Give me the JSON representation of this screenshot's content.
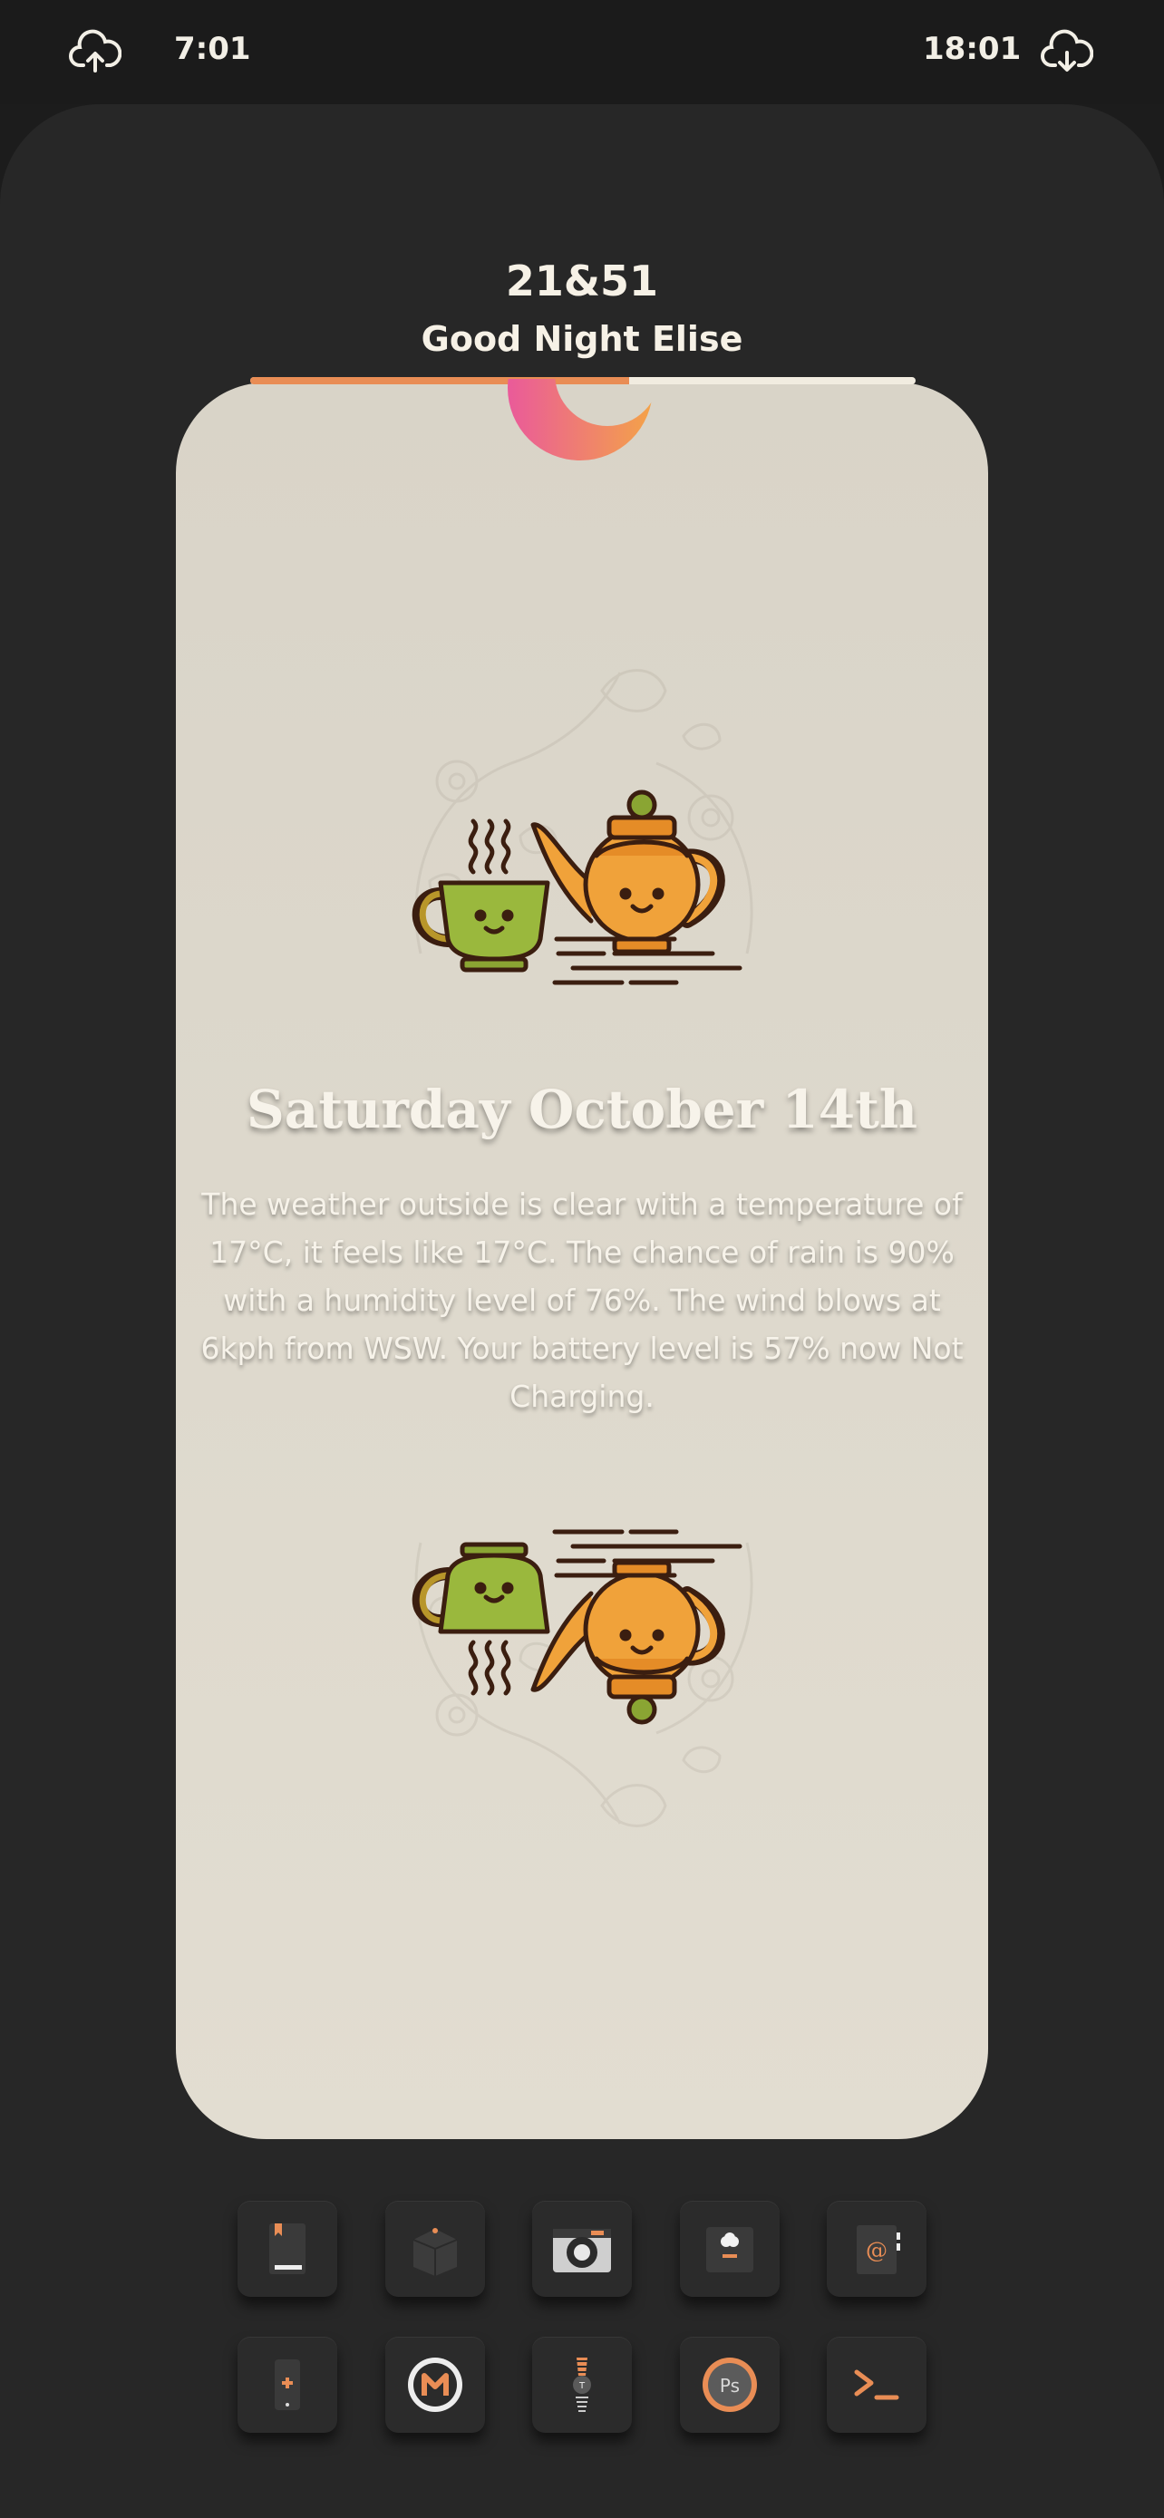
{
  "status_bar": {
    "sunrise_icon": "cloud-upload-icon",
    "sunrise_time": "7:01",
    "sunset_time": "18:01",
    "sunset_icon": "cloud-download-icon"
  },
  "header": {
    "counter": "21&51",
    "greeting": "Good Night Elise",
    "day_progress": 0.57,
    "moon_icon": "crescent-moon-icon"
  },
  "card": {
    "top_illustration": "teapot-pouring-tea-icon",
    "date": "Saturday October 14th",
    "weather_text": "The weather outside is clear with a temperature of 17°C, it feels like 17°C. The chance of rain is 90% with a humidity level of 76%. The wind blows at 6kph from WSW. Your battery level is 57% now Not Charging.",
    "bottom_illustration": "upside-down-teapot-icon"
  },
  "dock": {
    "row1": [
      "book-icon",
      "box-icon",
      "camera-icon",
      "inbox-icon",
      "contacts-icon"
    ],
    "row2": [
      "phone-icon",
      "mega-icon",
      "flashlight-icon",
      "photoshop-icon",
      "terminal-icon"
    ]
  },
  "colors": {
    "background": "#272727",
    "card": "#ddd8cc",
    "accent": "#e98d55",
    "text": "#f6f1e6",
    "teapot": "#f0a23a",
    "cup": "#9ab83d"
  }
}
